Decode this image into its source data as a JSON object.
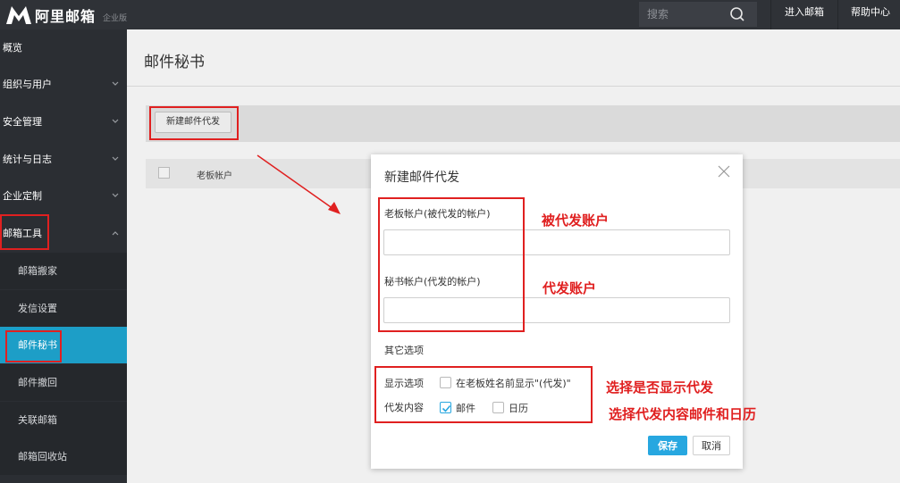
{
  "header": {
    "brand": "阿里邮箱",
    "edition": "企业版",
    "search_placeholder": "搜索",
    "links": [
      "进入邮箱",
      "帮助中心"
    ]
  },
  "sidebar": {
    "items": [
      {
        "label": "概览",
        "expandable": false
      },
      {
        "label": "组织与用户",
        "expandable": true
      },
      {
        "label": "安全管理",
        "expandable": true
      },
      {
        "label": "统计与日志",
        "expandable": true
      },
      {
        "label": "企业定制",
        "expandable": true
      },
      {
        "label": "邮箱工具",
        "expandable": true,
        "expanded": true
      }
    ],
    "sub_items": [
      "邮箱搬家",
      "发信设置",
      "邮件秘书",
      "邮件撤回",
      "关联邮箱",
      "邮箱回收站"
    ],
    "active_sub": "邮件秘书"
  },
  "main": {
    "title": "邮件秘书",
    "new_button": "新建邮件代发",
    "table_header": "老板帐户"
  },
  "modal": {
    "title": "新建邮件代发",
    "boss_label": "老板帐户(被代发的帐户)",
    "boss_value": "",
    "secretary_label": "秘书帐户(代发的帐户)",
    "secretary_value": "",
    "other_options": "其它选项",
    "display_label": "显示选项",
    "display_option": "在老板姓名前显示\"(代发)\"",
    "display_checked": false,
    "content_label": "代发内容",
    "content_mail": "邮件",
    "content_mail_checked": true,
    "content_calendar": "日历",
    "content_calendar_checked": false,
    "save": "保存",
    "cancel": "取消"
  },
  "annotations": {
    "boss_note": "被代发账户",
    "secretary_note": "代发账户",
    "display_note": "选择是否显示代发",
    "content_note": "选择代发内容邮件和日历"
  },
  "colors": {
    "topbar": "#2f3237",
    "sidebar": "#2b2e33",
    "active": "#1d9ec7",
    "primary_button": "#27a7e0",
    "annotation": "#e02020"
  }
}
